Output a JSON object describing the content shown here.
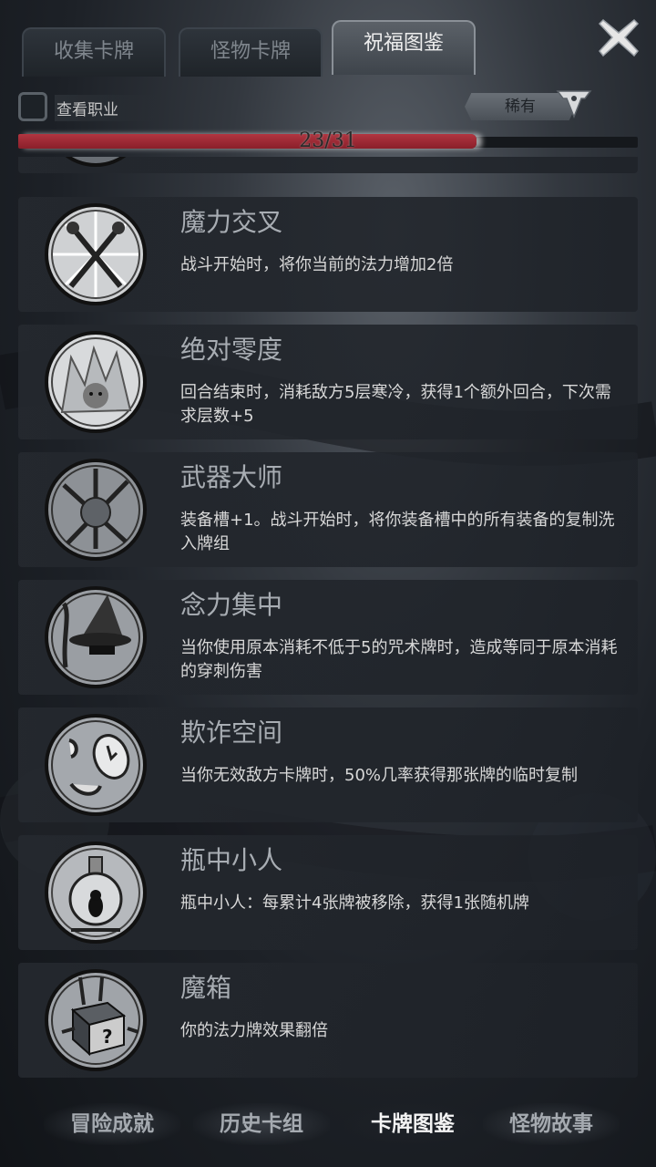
{
  "tabs": [
    {
      "label": "收集卡牌",
      "active": false
    },
    {
      "label": "怪物卡牌",
      "active": false
    },
    {
      "label": "祝福图鉴",
      "active": true
    }
  ],
  "filter": {
    "label": "查看职业",
    "checked": false,
    "rarity": "稀有"
  },
  "progress": {
    "text": "23/31",
    "fraction": 0.74
  },
  "cards": [
    {
      "name": "魔力交叉",
      "desc": "战斗开始时，将你当前的法力增加2倍",
      "icon": "crossed-wands-icon"
    },
    {
      "name": "绝对零度",
      "desc": "回合结束时，消耗敌方5层寒冷，获得1个额外回合，下次需求层数+5",
      "icon": "frozen-demon-icon"
    },
    {
      "name": "武器大师",
      "desc": "装备槽+1。战斗开始时，将你装备槽中的所有装备的复制洗入牌组",
      "icon": "weapon-master-icon"
    },
    {
      "name": "念力集中",
      "desc": "当你使用原本消耗不低于5的咒术牌时，造成等同于原本消耗的穿刺伤害",
      "icon": "wizard-icon"
    },
    {
      "name": "欺诈空间",
      "desc": "当你无效敌方卡牌时，50%几率获得那张牌的临时复制",
      "icon": "distorted-space-icon"
    },
    {
      "name": "瓶中小人",
      "desc": "瓶中小人：每累计4张牌被移除，获得1张随机牌",
      "icon": "bottle-imp-icon"
    },
    {
      "name": "魔箱",
      "desc": "你的法力牌效果翻倍",
      "icon": "magic-box-icon"
    }
  ],
  "bottom_nav": [
    {
      "label": "冒险成就",
      "active": false
    },
    {
      "label": "历史卡组",
      "active": false
    },
    {
      "label": "卡牌图鉴",
      "active": true
    },
    {
      "label": "怪物故事",
      "active": false
    }
  ]
}
